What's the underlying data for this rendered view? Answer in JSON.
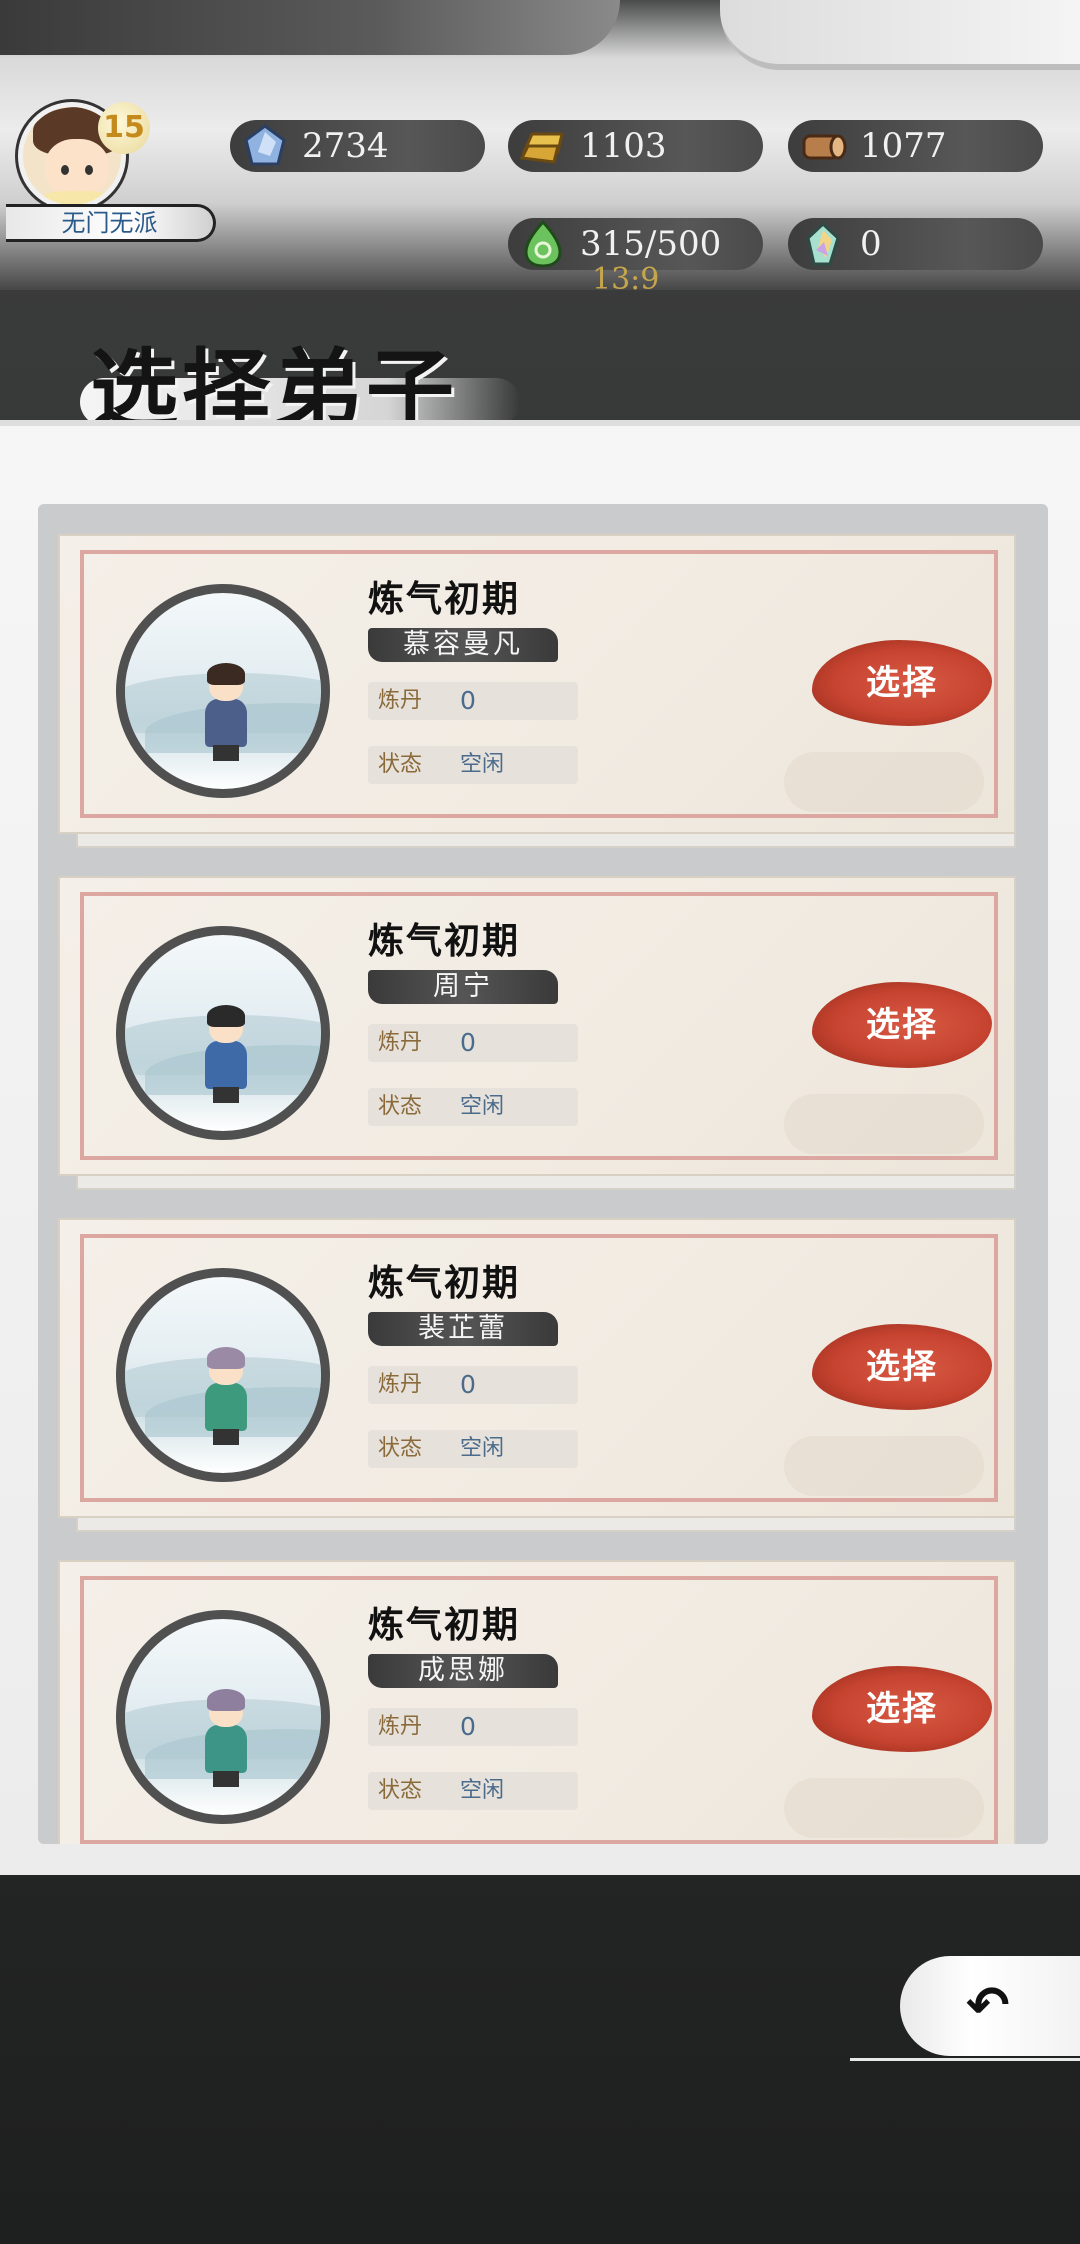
{
  "header": {
    "player": {
      "level": "15",
      "sect": "无门无派"
    },
    "resources": [
      {
        "icon": "spirit-stone-icon",
        "value": "2734",
        "color": "#7fa6d9"
      },
      {
        "icon": "gold-ingot-icon",
        "value": "1103",
        "color": "#e3b94a"
      },
      {
        "icon": "wood-log-icon",
        "value": "1077",
        "color": "#b57a4a"
      },
      {
        "icon": "green-gem-icon",
        "value": "315/500",
        "color": "#5fbf5a"
      },
      {
        "icon": "rainbow-crystal-icon",
        "value": "0",
        "color": "#9fd9c9"
      }
    ],
    "timer": "13:9"
  },
  "title": "选择弟子",
  "disciples": [
    {
      "realm": "炼气初期",
      "name": "慕容曼凡",
      "alchemy_label": "炼丹",
      "alchemy_value": "0",
      "status_label": "状态",
      "status_value": "空闲",
      "select_label": "选择",
      "hair_color": "#3a2a22",
      "robe_color": "#4b5f8a"
    },
    {
      "realm": "炼气初期",
      "name": "周宁",
      "alchemy_label": "炼丹",
      "alchemy_value": "0",
      "status_label": "状态",
      "status_value": "空闲",
      "select_label": "选择",
      "hair_color": "#2a2a2a",
      "robe_color": "#3f6aa8"
    },
    {
      "realm": "炼气初期",
      "name": "裴芷蕾",
      "alchemy_label": "炼丹",
      "alchemy_value": "0",
      "status_label": "状态",
      "status_value": "空闲",
      "select_label": "选择",
      "hair_color": "#9a8aa6",
      "robe_color": "#3d9a7c"
    },
    {
      "realm": "炼气初期",
      "name": "成思娜",
      "alchemy_label": "炼丹",
      "alchemy_value": "0",
      "status_label": "状态",
      "status_value": "空闲",
      "select_label": "选择",
      "hair_color": "#8f7f9e",
      "robe_color": "#3c9587"
    }
  ],
  "footer": {
    "back_icon": "back-arrow-icon"
  }
}
